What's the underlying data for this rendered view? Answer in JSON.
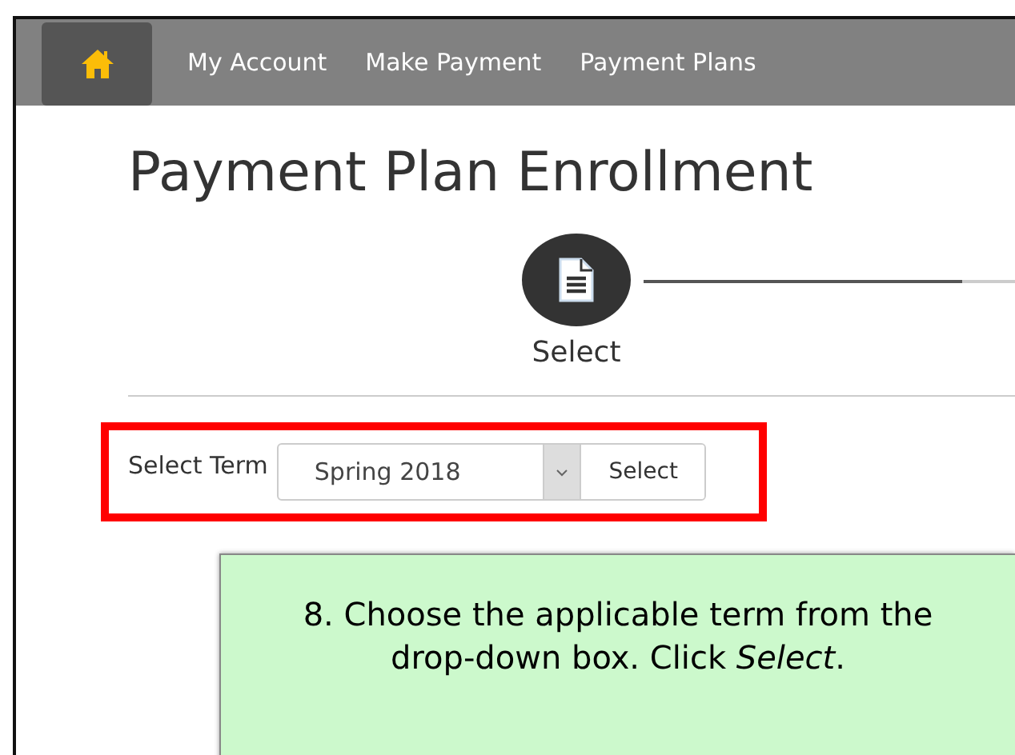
{
  "nav": {
    "items": [
      {
        "kind": "home",
        "selected": true
      },
      {
        "kind": "link",
        "label": "My Account",
        "selected": false
      },
      {
        "kind": "link",
        "label": "Make Payment",
        "selected": false
      },
      {
        "kind": "link",
        "label": "Payment Plans",
        "selected": false
      }
    ]
  },
  "title": "Payment Plan Enrollment",
  "steps": [
    {
      "label": "Select",
      "selected": true
    }
  ],
  "term_form": {
    "label": "Select Term",
    "value": "Spring 2018",
    "button": "Select",
    "highlighted": true
  },
  "callout": {
    "text": "8. Choose the applicable term from the drop-down box. Click *Select*."
  }
}
